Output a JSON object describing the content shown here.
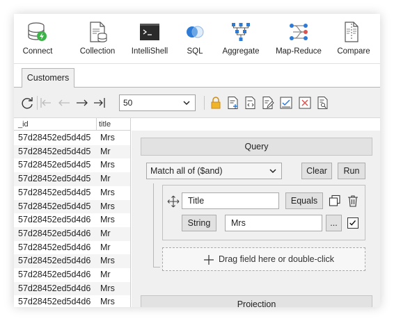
{
  "ribbon": [
    {
      "label": "Connect",
      "icon": "connect-icon"
    },
    {
      "label": "Collection",
      "icon": "collection-icon"
    },
    {
      "label": "IntelliShell",
      "icon": "intellishell-icon"
    },
    {
      "label": "SQL",
      "icon": "sql-icon"
    },
    {
      "label": "Aggregate",
      "icon": "aggregate-icon"
    },
    {
      "label": "Map-Reduce",
      "icon": "map-reduce-icon"
    },
    {
      "label": "Compare",
      "icon": "compare-icon"
    }
  ],
  "tabs": [
    {
      "label": "Customers",
      "active": true
    }
  ],
  "toolbar": {
    "page_size": "50",
    "icons": [
      "refresh-icon",
      "first-page-icon",
      "prev-page-icon",
      "next-page-icon",
      "last-page-icon",
      "lock-icon",
      "add-document-icon",
      "view-json-icon",
      "edit-document-icon",
      "validate-icon",
      "delete-document-icon",
      "find-icon"
    ]
  },
  "grid": {
    "columns": [
      "_id",
      "title"
    ],
    "rows": [
      {
        "id": "57d28452ed5d4d5",
        "title": "Mrs"
      },
      {
        "id": "57d28452ed5d4d5",
        "title": "Mr"
      },
      {
        "id": "57d28452ed5d4d5",
        "title": "Mrs"
      },
      {
        "id": "57d28452ed5d4d5",
        "title": "Mr"
      },
      {
        "id": "57d28452ed5d4d5",
        "title": "Mrs"
      },
      {
        "id": "57d28452ed5d4d5",
        "title": "Mrs"
      },
      {
        "id": "57d28452ed5d4d6",
        "title": "Mrs"
      },
      {
        "id": "57d28452ed5d4d6",
        "title": "Mr"
      },
      {
        "id": "57d28452ed5d4d6",
        "title": "Mr"
      },
      {
        "id": "57d28452ed5d4d6",
        "title": "Mrs"
      },
      {
        "id": "57d28452ed5d4d6",
        "title": "Mr"
      },
      {
        "id": "57d28452ed5d4d6",
        "title": "Mrs"
      },
      {
        "id": "57d28452ed5d4d6",
        "title": "Mrs"
      }
    ]
  },
  "query": {
    "section_title": "Query",
    "match_mode": "Match all of ($and)",
    "clear_label": "Clear",
    "run_label": "Run",
    "condition": {
      "field": "Title",
      "operator": "Equals",
      "type": "String",
      "value": "Mrs",
      "more_label": "...",
      "enabled": true
    },
    "drop_hint": "Drag field here or double-click"
  },
  "projection": {
    "section_title": "Projection"
  }
}
